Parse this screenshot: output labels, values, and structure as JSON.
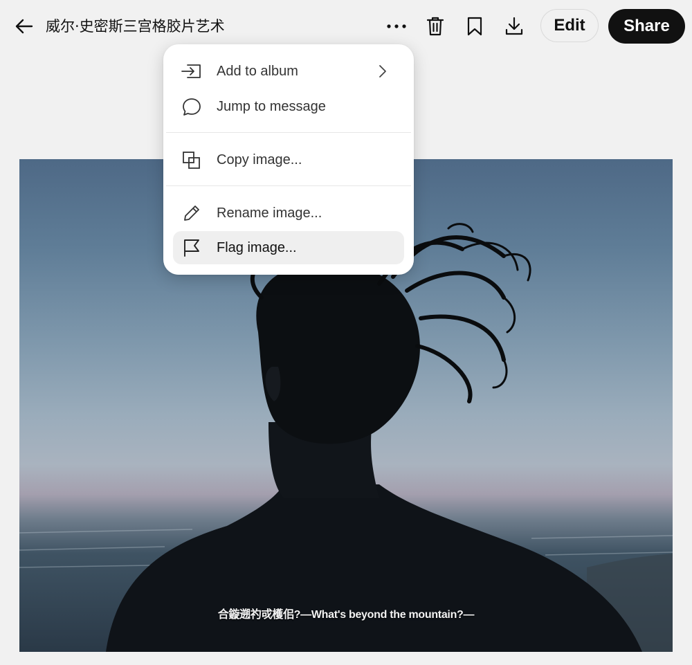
{
  "header": {
    "title": "威尔·史密斯三宫格胶片艺术",
    "edit_label": "Edit",
    "share_label": "Share"
  },
  "icons": {
    "back": "arrow-left-icon",
    "more": "more-horizontal-icon",
    "trash": "trash-icon",
    "bookmark": "bookmark-icon",
    "download": "download-icon"
  },
  "menu": {
    "items": [
      {
        "label": "Add to album",
        "icon": "add-to-album-icon",
        "has_submenu": true
      },
      {
        "label": "Jump to message",
        "icon": "speech-bubble-icon"
      },
      {
        "label": "Copy image...",
        "icon": "copy-icon"
      },
      {
        "label": "Rename image...",
        "icon": "pencil-icon"
      },
      {
        "label": "Flag image...",
        "icon": "flag-icon",
        "highlighted": true
      }
    ]
  },
  "image": {
    "subtitle": "合鏇遡礿戓檴佀?—What's beyond the mountain?—"
  },
  "colors": {
    "background": "#f1f1f1",
    "share_button": "#111111",
    "menu_background": "#ffffff",
    "menu_highlight": "#efefef"
  }
}
